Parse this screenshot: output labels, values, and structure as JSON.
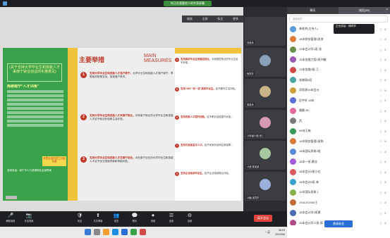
{
  "window": {
    "share_banner": "你正在观看他人的共享屏幕"
  },
  "share_toolbar": {
    "time": "06:03",
    "items": [
      "缩放",
      "全屏",
      "标注",
      "更多"
    ]
  },
  "slide": {
    "green_head": "(关于支持大学毕业生和技能人才来南宁就业创业的实施意见)",
    "green_title": "简称南宁“人才16条”",
    "badge": "本意见自印发之日起实施",
    "note": "咨询电话：南宁市人力资源和社会保障局",
    "main_title": "主要举措",
    "main_sub": "MAIN MEASURES",
    "middle_items": [
      {
        "num": "1",
        "head": "支持大学毕业生和技能人才落户南宁。",
        "text": "大学毕业生和技能人才落户南宁，享受相关政策支持，放宽落户条件。"
      },
      {
        "num": "2",
        "head": "支持大学毕业生和技能人才来南宁就业。",
        "text": "对来南宁就业的大学毕业生和技能人才给予就业补贴和生活补贴。"
      },
      {
        "num": "3",
        "head": "支持大学毕业生和技能人才在南宁创业。",
        "text": "对在南宁创业的大学毕业生和技能人才给予创业担保贷款和场租补贴。"
      }
    ],
    "right_items": [
      {
        "num": "4",
        "head": "支持高校毕业生到基层就业。",
        "text": "对到基层就业的毕业生给予补助。"
      },
      {
        "num": "5",
        "head": "支持“985”“双一流”高校毕业生。",
        "text": "给予额外生活补贴。"
      },
      {
        "num": "6",
        "head": "支持技能人才提升技能。",
        "text": "给予职业技能提升补贴。"
      },
      {
        "num": "7",
        "head": "支持引进高层次人才。",
        "text": "给予安家补贴和住房保障。"
      },
      {
        "num": "8",
        "head": "支持企业吸纳毕业生。",
        "text": "给予企业吸纳就业补贴。"
      }
    ]
  },
  "tiles": [
    {
      "name": "刘老师"
    },
    {
      "name": "杨同学"
    },
    {
      "name": "周老师"
    },
    {
      "name": "15年级20班-张三"
    },
    {
      "name": "15班-陈某某"
    },
    {
      "name": "18届-某同学"
    }
  ],
  "panel": {
    "tabs": [
      "聊天",
      "成员(55)"
    ],
    "close": "×",
    "search_placeholder": "搜索成员",
    "speaking": "正在讲话：杨同学",
    "invite": "邀请参会",
    "members": [
      {
        "name": "林老师(主持人)",
        "color": "#5a9bd8"
      },
      {
        "name": "18本财务管理1班李",
        "color": "#e07b39"
      },
      {
        "name": "19本会计学1班-张",
        "color": "#6c8e4a"
      },
      {
        "name": "15本金融工程1班刘敏",
        "color": "#9a59b5"
      },
      {
        "name": "19本金融2班-王",
        "color": "#d04a4a"
      },
      {
        "name": "张晓丽5班",
        "color": "#4aa8a0"
      },
      {
        "name": "邓思源19本会计",
        "color": "#c9a23a"
      },
      {
        "name": "彭宇轩 18本",
        "color": "#5a6fd8"
      },
      {
        "name": "雅静-30",
        "color": "#e06b9a"
      },
      {
        "name": "西",
        "color": "#7a7a7a"
      },
      {
        "name": "05何玉梅",
        "color": "#3a9a5a"
      },
      {
        "name": "18本财务管理1班陈",
        "color": "#d87a3a"
      },
      {
        "name": "18本国际贸易2班",
        "color": "#5a8ad8"
      },
      {
        "name": "18本一班-黄佳",
        "color": "#a05ad8"
      },
      {
        "name": "18本会计2班小红",
        "color": "#d85a5a"
      },
      {
        "name": "18本会计5班-林",
        "color": "#3aa0d0"
      },
      {
        "name": "19本国际贸易 1",
        "color": "#8ab04a"
      },
      {
        "name": "1941202005王",
        "color": "#c06a3a"
      },
      {
        "name": "18本会计学2班黄",
        "color": "#4a6ab0"
      },
      {
        "name": "19本会计学二班-周",
        "color": "#b04a8a"
      },
      {
        "name": "18本财务管理陈",
        "color": "#6aa06a"
      }
    ]
  },
  "bottombar": {
    "buttons": [
      {
        "icon": "🎤",
        "label": "解除静音"
      },
      {
        "icon": "📷",
        "label": "开启视频"
      },
      {
        "icon": "🛡",
        "label": "安全"
      },
      {
        "icon": "⬆",
        "label": "共享屏幕"
      },
      {
        "icon": "👥",
        "label": "成员"
      },
      {
        "icon": "💬",
        "label": "聊天"
      },
      {
        "icon": "⏺",
        "label": "录制"
      },
      {
        "icon": "☰",
        "label": "应用"
      },
      {
        "icon": "⚙",
        "label": "设置"
      }
    ],
    "leave": "离开会议"
  },
  "taskbar": {
    "time": "06:03",
    "date": "2021/5/6",
    "tray": "^ 英"
  }
}
